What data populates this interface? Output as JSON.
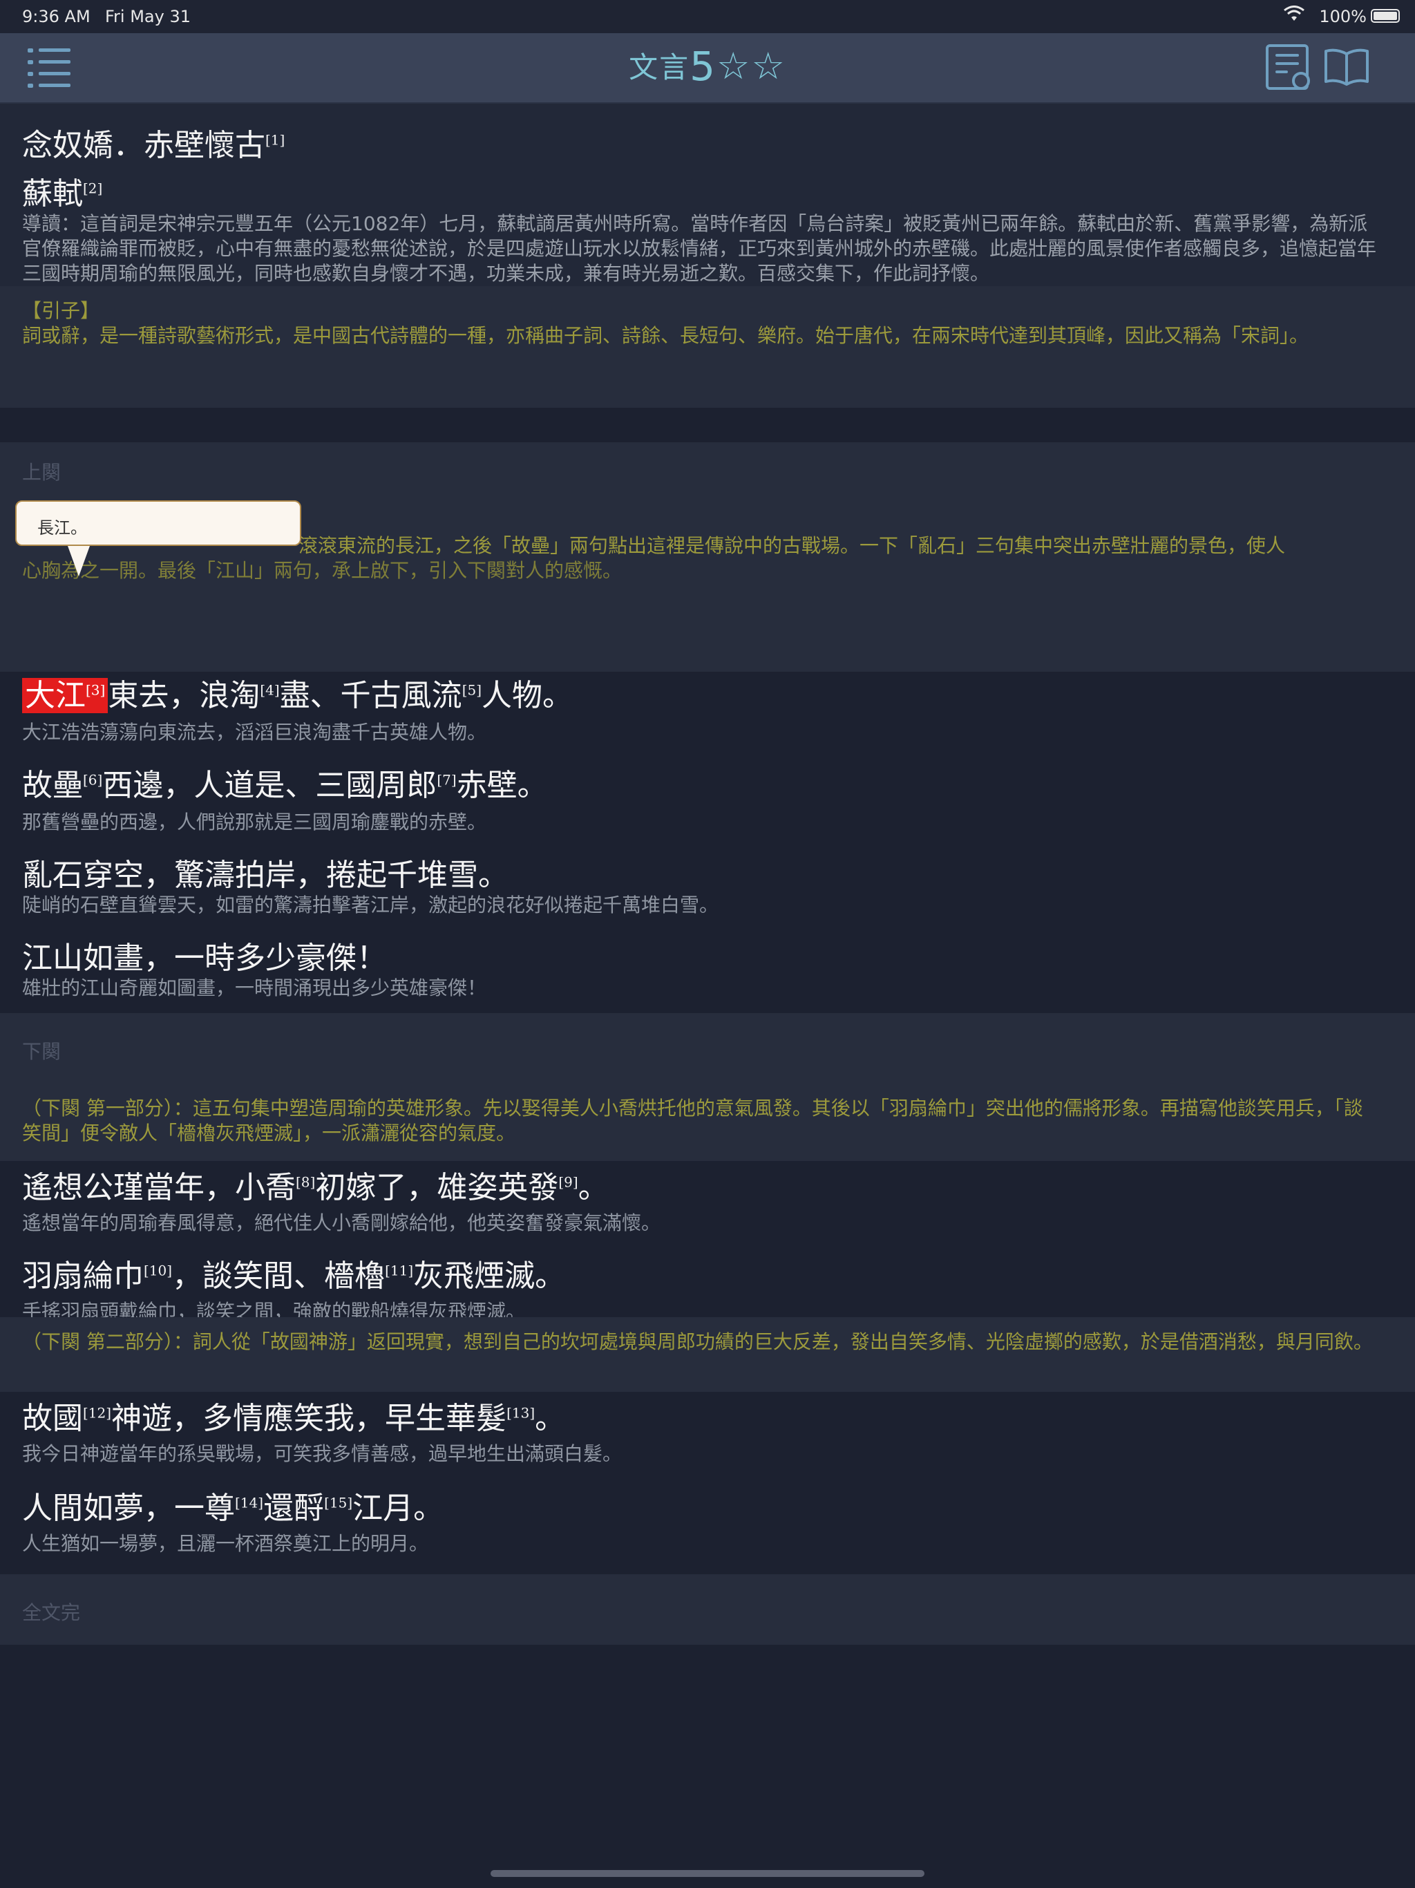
{
  "status": {
    "time": "9:36 AM",
    "date": "Fri May 31",
    "battery": "100%",
    "wifi_icon": "wifi-icon"
  },
  "nav": {
    "title_prefix": "文言",
    "level": "5",
    "stars": "☆☆",
    "menu_icon": "list-menu-icon",
    "search_icon": "document-search-icon",
    "book_icon": "open-book-icon"
  },
  "header": {
    "poem_title": "念奴嬌．赤壁懷古",
    "poem_title_note": "[1]",
    "author": "蘇軾",
    "author_note": "[2]",
    "intro": "導讀：這首詞是宋神宗元豐五年（公元1082年）七月，蘇軾謫居黃州時所寫。當時作者因「烏台詩案」被貶黃州已兩年餘。蘇軾由於新、舊黨爭影響，為新派官僚羅織論罪而被貶，心中有無盡的憂愁無從述說，於是四處遊山玩水以放鬆情緒，正巧來到黃州城外的赤壁磯。此處壯麗的風景使作者感觸良多，追憶起當年三國時期周瑜的無限風光，同時也感歎自身懷才不遇，功業未成，兼有時光易逝之歎。百感交集下，作此詞抒懷。"
  },
  "preface": {
    "heading": "【引子】",
    "text": "詞或辭，是一種詩歌藝術形式，是中國古代詩體的一種，亦稱曲子詞、詩餘、長短句、樂府。始于唐代，在兩宋時代達到其頂峰，因此又稱為「宋詞」。"
  },
  "upper": {
    "label": "上闋",
    "commentary": "（上闋）：首句寫出滾滾東流的長江，之後「故壘」兩句點出這裡是傳說中的古戰場。一下「亂石」三句集中突出赤壁壯麗的景色，使人心胸為之一開。最後「江山」兩句，承上啟下，引入下闋對人的感慨。",
    "commentary_visible": "滾滾東流的長江，之後「故壘」兩句點出這裡是傳說中的古戰場。一下「亂石」三句集中突出赤壁壯麗的景色，使人",
    "commentary_visible_2": "兩句，承上啟下，引入下闋對人的感慨。"
  },
  "tooltip": {
    "text": "長江。"
  },
  "verses": [
    {
      "hl": "大江",
      "n1": "[3]",
      "a": "東去，浪淘",
      "n2": "[4]",
      "b": "盡、千古風流",
      "n3": "[5]",
      "c": "人物。",
      "trans": "大江浩浩蕩蕩向東流去，滔滔巨浪淘盡千古英雄人物。"
    },
    {
      "a": "故壘",
      "n1": "[6]",
      "b": "西邊，人道是、三國周郎",
      "n2": "[7]",
      "c": "赤壁。",
      "trans": "那舊營壘的西邊，人們說那就是三國周瑜鏖戰的赤壁。"
    },
    {
      "a": "亂石穿空，驚濤拍岸，捲起千堆雪。",
      "trans": "陡峭的石壁直聳雲天，如雷的驚濤拍擊著江岸，激起的浪花好似捲起千萬堆白雪。"
    },
    {
      "a": "江山如畫，一時多少豪傑！",
      "trans": "雄壯的江山奇麗如圖畫，一時間涌現出多少英雄豪傑！"
    }
  ],
  "lower": {
    "label": "下闋",
    "part1": "（下闋 第一部分）：這五句集中塑造周瑜的英雄形象。先以娶得美人小喬烘托他的意氣風發。其後以「羽扇綸巾」突出他的儒將形象。再描寫他談笑用兵，「談笑間」便令敵人「檣櫓灰飛煙滅」，一派瀟灑從容的氣度。",
    "part2": "（下闋 第二部分）：詞人從「故國神游」返回現實，想到自己的坎坷處境與周郎功績的巨大反差，發出自笑多情、光陰虛擲的感歎，於是借酒消愁，與月同飲。"
  },
  "verses2": [
    {
      "a": "遙想公瑾當年，小喬",
      "n1": "[8]",
      "b": "初嫁了，雄姿英發",
      "n2": "[9]",
      "c": "。",
      "trans": "遙想當年的周瑜春風得意，絕代佳人小喬剛嫁給他，他英姿奮發豪氣滿懷。"
    },
    {
      "a": "羽扇綸巾",
      "n1": "[10]",
      "b": "，談笑間、檣櫓",
      "n2": "[11]",
      "c": "灰飛煙滅。",
      "trans": "手搖羽扇頭戴綸巾，談笑之間，強敵的戰船燒得灰飛煙滅。"
    },
    {
      "a": "故國",
      "n1": "[12]",
      "b": "神遊，多情應笑我，早生華髮",
      "n2": "[13]",
      "c": "。",
      "trans": "我今日神遊當年的孫吳戰場，可笑我多情善感，過早地生出滿頭白髮。"
    },
    {
      "a": "人間如夢，一尊",
      "n1": "[14]",
      "b": "還酹",
      "n2": "[15]",
      "c": "江月。",
      "trans": "人生猶如一場夢，且灑一杯酒祭奠江上的明月。"
    }
  ],
  "footer": {
    "end_label": "全文完"
  }
}
